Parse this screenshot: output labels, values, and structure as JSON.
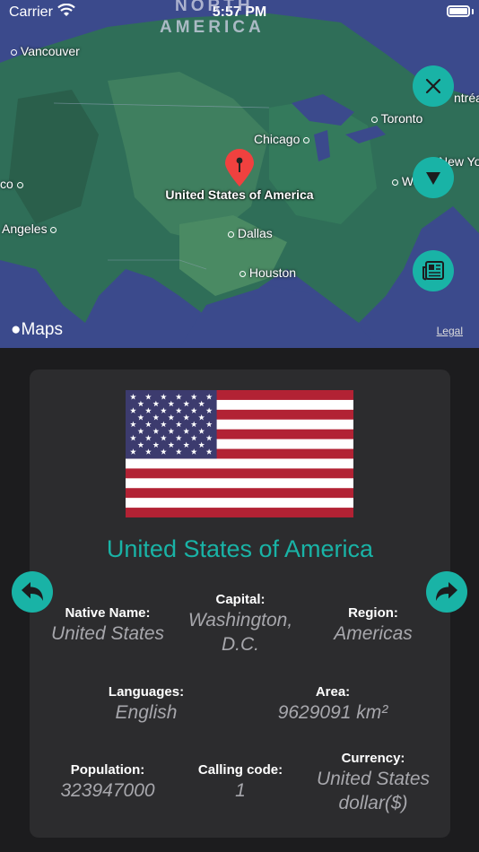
{
  "status_bar": {
    "carrier": "Carrier",
    "time": "5:57 PM"
  },
  "map": {
    "region_label_1": "NORTH",
    "region_label_2": "AMERICA",
    "cities": {
      "vancouver": "Vancouver",
      "chicago": "Chicago",
      "toronto": "Toronto",
      "new_york": "New York",
      "montreal": "ntréa",
      "washington": "Wa    ton",
      "co": "co",
      "angeles": "Angeles",
      "dallas": "Dallas",
      "houston": "Houston"
    },
    "pin_label": "United States of America",
    "maps_brand": "Maps",
    "legal": "Legal"
  },
  "buttons": {
    "close_icon": "close-icon",
    "collapse_icon": "triangle-down-icon",
    "news_icon": "newspaper-icon",
    "prev_icon": "arrow-left-icon",
    "next_icon": "arrow-right-icon"
  },
  "colors": {
    "accent": "#19b3a6",
    "card": "#2c2c2e",
    "background": "#1c1c1e",
    "value_text": "#a7a7ac"
  },
  "country": {
    "name": "United States of America",
    "flag": "united-states-flag",
    "fields": {
      "native_name": {
        "label": "Native Name:",
        "value": "United States"
      },
      "capital": {
        "label": "Capital:",
        "value_line1": "Washington,",
        "value_line2": "D.C."
      },
      "region": {
        "label": "Region:",
        "value": "Americas"
      },
      "languages": {
        "label": "Languages:",
        "value": "English"
      },
      "area": {
        "label": "Area:",
        "value": "9629091 km²"
      },
      "population": {
        "label": "Population:",
        "value": "323947000"
      },
      "calling_code": {
        "label": "Calling code:",
        "value": "1"
      },
      "currency": {
        "label": "Currency:",
        "value_line1": "United States",
        "value_line2": "dollar($)"
      }
    }
  }
}
